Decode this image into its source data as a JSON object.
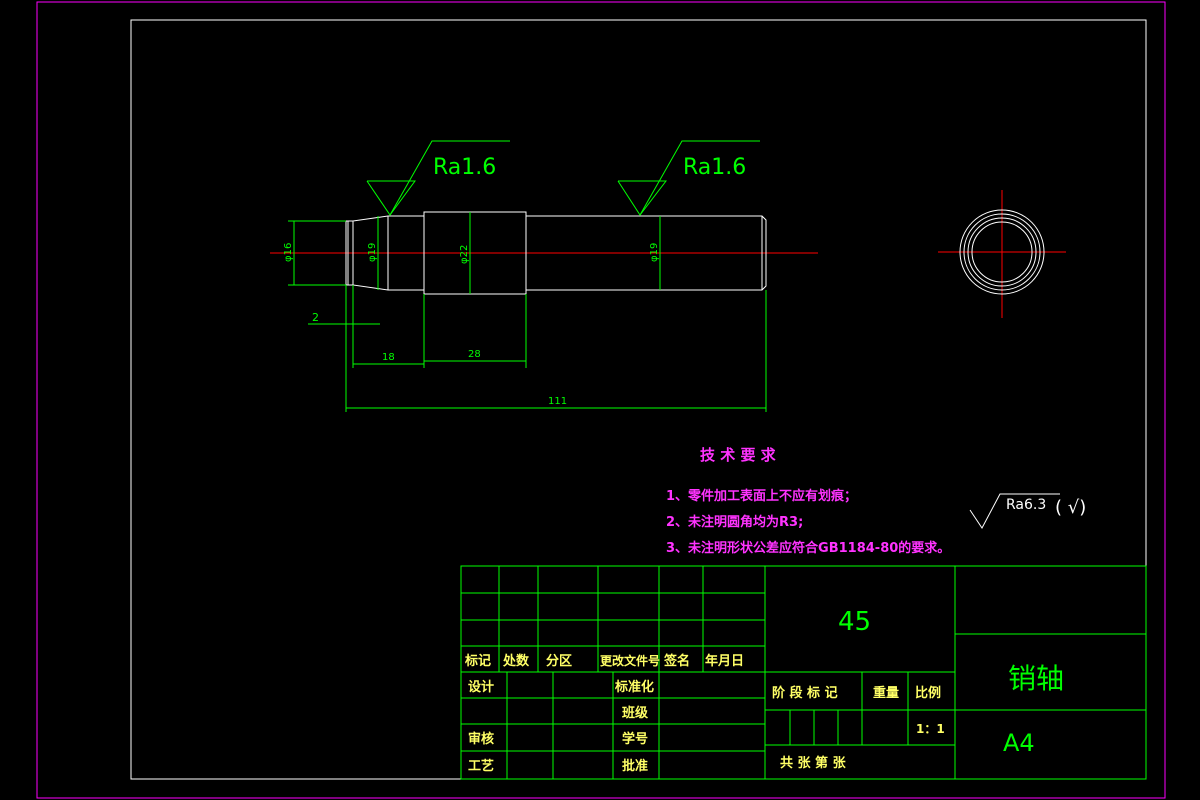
{
  "drawing": {
    "surface_finish": {
      "mark_1": "Ra1.6",
      "mark_2": "Ra1.6",
      "general": "Ra6.3",
      "general_suffix": "(  √)"
    },
    "diameters": {
      "d1": "φ16",
      "d2": "φ19",
      "d3": "φ22",
      "d4": "φ19"
    },
    "lengths": {
      "chamfer": "2",
      "l1": "18",
      "l2": "28",
      "total": "111"
    }
  },
  "tech_requirements": {
    "title": "技 术 要 求",
    "items": [
      "1、零件加工表面上不应有划痕；",
      "2、未注明圆角均为R3;",
      "3、未注明形状公差应符合GB1184-80的要求。"
    ]
  },
  "title_block": {
    "material": "45",
    "part_name": "销轴",
    "sheet_size": "A4",
    "row_headers": [
      "标记",
      "处数",
      "分区",
      "更改文件号",
      "签名",
      "年月日"
    ],
    "design": "设计",
    "standardization": "标准化",
    "review": "审核",
    "process": "工艺",
    "approve": "批准",
    "class": "班级",
    "student_no": "学号",
    "stage_mark": "阶 段 标 记",
    "weight": "重量",
    "scale_label": "比例",
    "scale_value": "1：1",
    "sheets": "共     张   第     张"
  },
  "colors": {
    "outline": "#00ff00",
    "part": "#ffffff",
    "centerline": "#ff0000",
    "border": "#ff00ff",
    "text": "#ff33ff"
  }
}
